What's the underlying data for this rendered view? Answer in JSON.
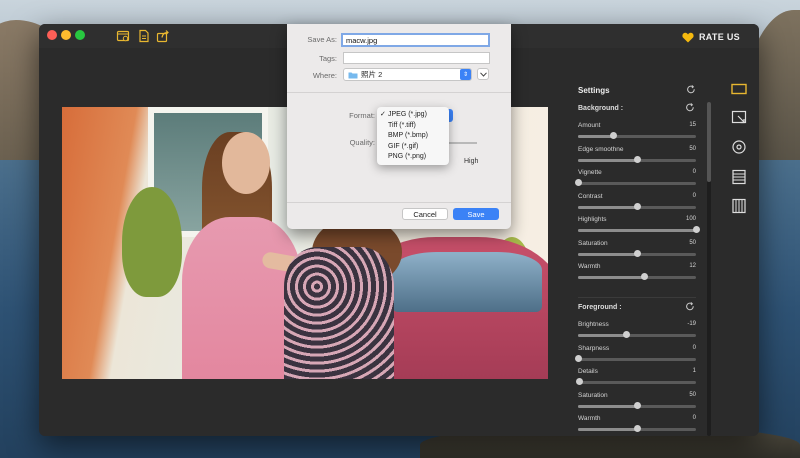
{
  "toolbar": {
    "rate_label": "RATE US"
  },
  "panel": {
    "title": "Settings",
    "background_section": "Background :",
    "foreground_section": "Foreground :",
    "background_sliders": [
      {
        "label": "Amount",
        "value": "15",
        "level": 0.3
      },
      {
        "label": "Edge smoothne",
        "value": "50",
        "level": 0.5
      },
      {
        "label": "Vignette",
        "value": "0",
        "level": 0.0
      },
      {
        "label": "Contrast",
        "value": "0",
        "level": 0.5
      },
      {
        "label": "Highlights",
        "value": "100",
        "level": 1.0
      },
      {
        "label": "Saturation",
        "value": "50",
        "level": 0.5
      },
      {
        "label": "Warmth",
        "value": "12",
        "level": 0.56
      }
    ],
    "foreground_sliders": [
      {
        "label": "Brightness",
        "value": "-19",
        "level": 0.41
      },
      {
        "label": "Sharpness",
        "value": "0",
        "level": 0.0
      },
      {
        "label": "Details",
        "value": "1",
        "level": 0.01
      },
      {
        "label": "Saturation",
        "value": "50",
        "level": 0.5
      },
      {
        "label": "Warmth",
        "value": "0",
        "level": 0.5
      }
    ]
  },
  "dialog": {
    "save_as_label": "Save As:",
    "filename": "macw.jpg",
    "tags_label": "Tags:",
    "tags_value": "",
    "where_label": "Where:",
    "where_value": "照片 2",
    "format_label": "Format:",
    "quality_label": "Quality:",
    "quality_high": "High",
    "format_options": [
      {
        "label": "JPEG (*.jpg)",
        "checked": true
      },
      {
        "label": "Tiff (*.tiff)",
        "checked": false
      },
      {
        "label": "BMP (*.bmp)",
        "checked": false
      },
      {
        "label": "GIF (*.gif)",
        "checked": false
      },
      {
        "label": "PNG (*.png)",
        "checked": false
      }
    ],
    "checkmark": "✓",
    "cancel_label": "Cancel",
    "save_label": "Save"
  },
  "colors": {
    "accent": "#3b82f6",
    "window_bg": "#2b2b2b",
    "heart": "#f5b90f",
    "toolbar_icon": "#e8b730"
  }
}
